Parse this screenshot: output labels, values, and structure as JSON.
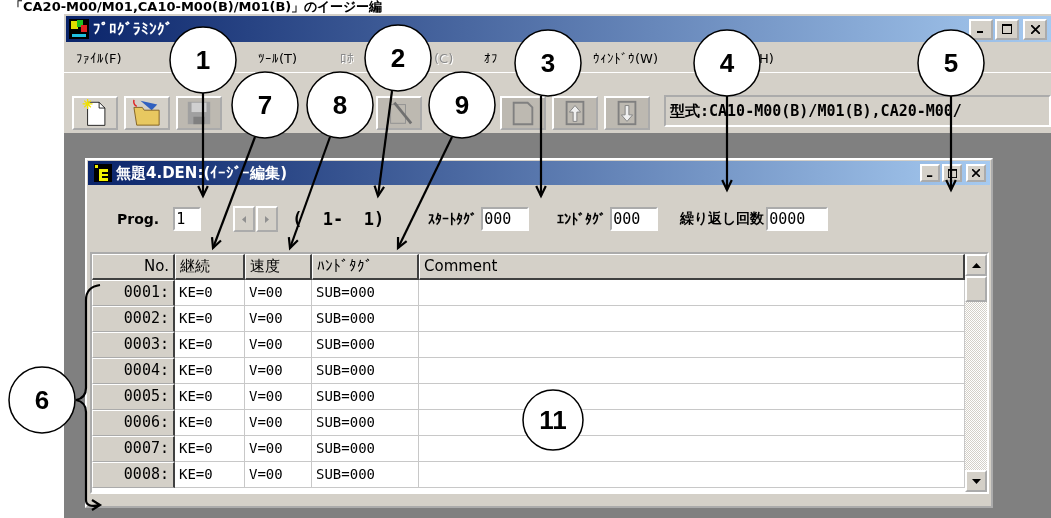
{
  "caption": "「CA20-M00/M01,CA10-M00(B)/M01(B)」のイージー編",
  "window": {
    "title": "ﾌﾟﾛｸﾞﾗﾐﾝｸﾞ"
  },
  "menu": [
    {
      "label": "ﾌｧｲﾙ(F)",
      "disabled": false
    },
    {
      "label": "ﾂｰﾙ(T)",
      "disabled": false
    },
    {
      "label": "ﾛﾎ",
      "disabled": true
    },
    {
      "label": "(C)",
      "disabled": true
    },
    {
      "label": "ｵﾌ",
      "disabled": false
    },
    {
      "label": "ｳｨﾝﾄﾞｳ(W)",
      "disabled": false
    },
    {
      "label": "H)",
      "disabled": false
    }
  ],
  "toolbar": [
    {
      "kind": "new",
      "disabled": false
    },
    {
      "kind": "open",
      "disabled": false
    },
    {
      "kind": "save",
      "disabled": true
    },
    {
      "kind": "wand",
      "disabled": true
    },
    {
      "kind": "page",
      "disabled": true
    },
    {
      "kind": "upload",
      "disabled": true
    },
    {
      "kind": "download",
      "disabled": true
    }
  ],
  "model_field": {
    "value": "型式:CA10-M00(B)/M01(B),CA20-M00/"
  },
  "document": {
    "title": "無題4.DEN:(ｲｰｼﾞｰ編集)",
    "prog_label": "Prog.",
    "prog_value": "1",
    "spin_buttons": [
      {
        "disabled": true
      },
      {
        "disabled": true
      }
    ],
    "range": "(  1-  1)",
    "start_tag_label": "ｽﾀｰﾄﾀｸﾞ",
    "start_tag_value": "000",
    "end_tag_label": "ｴﾝﾄﾞﾀｸﾞ",
    "end_tag_value": "000",
    "repeat_label": "繰り返し回数",
    "repeat_value": "0000"
  },
  "table": {
    "columns": [
      "No.",
      "継続",
      "速度",
      "ﾊﾝﾄﾞﾀｸﾞ",
      "Comment"
    ],
    "rows": [
      [
        "0001:",
        "KE=0",
        "V=00",
        "SUB=000"
      ],
      [
        "0002:",
        "KE=0",
        "V=00",
        "SUB=000"
      ],
      [
        "0003:",
        "KE=0",
        "V=00",
        "SUB=000"
      ],
      [
        "0004:",
        "KE=0",
        "V=00",
        "SUB=000"
      ],
      [
        "0005:",
        "KE=0",
        "V=00",
        "SUB=000"
      ],
      [
        "0006:",
        "KE=0",
        "V=00",
        "SUB=000"
      ],
      [
        "0007:",
        "KE=0",
        "V=00",
        "SUB=000"
      ],
      [
        "0008:",
        "KE=0",
        "V=00",
        "SUB=000"
      ]
    ]
  },
  "callouts": [
    "1",
    "2",
    "3",
    "4",
    "5",
    "6",
    "7",
    "8",
    "9",
    "11"
  ]
}
